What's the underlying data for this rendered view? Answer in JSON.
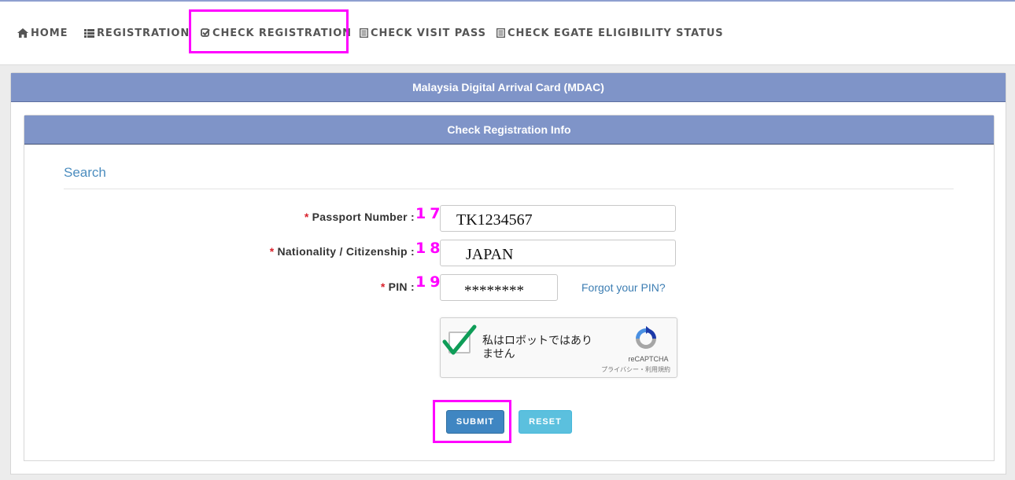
{
  "nav": {
    "items": [
      {
        "label": "HOME",
        "icon": "home-icon"
      },
      {
        "label": "REGISTRATION",
        "icon": "list-icon"
      },
      {
        "label": "CHECK REGISTRATION",
        "icon": "check-square-icon"
      },
      {
        "label": "CHECK VISIT PASS",
        "icon": "document-icon"
      },
      {
        "label": "CHECK EGATE ELIGIBILITY STATUS",
        "icon": "document-icon"
      }
    ]
  },
  "panel": {
    "title": "Malaysia Digital Arrival Card (MDAC)",
    "inner_title": "Check Registration Info",
    "section_title": "Search"
  },
  "form": {
    "required_mark": "*",
    "passport": {
      "label": "Passport Number :",
      "step": "17",
      "value": "TK1234567"
    },
    "nationality": {
      "label": "Nationality / Citizenship :",
      "step": "18",
      "value": "JAPAN"
    },
    "pin": {
      "label": "PIN :",
      "step": "19",
      "value": "********"
    },
    "forgot_pin": "Forgot your PIN?"
  },
  "captcha": {
    "text": "私はロボットではありません",
    "brand": "reCAPTCHA",
    "terms": "プライバシー・利用規約",
    "checked": true
  },
  "buttons": {
    "submit": "SUBMIT",
    "reset": "RESET"
  },
  "colors": {
    "header": "#7f94c8",
    "highlight": "#ff00ff",
    "submit": "#3f86c2",
    "reset": "#5bc0de"
  }
}
